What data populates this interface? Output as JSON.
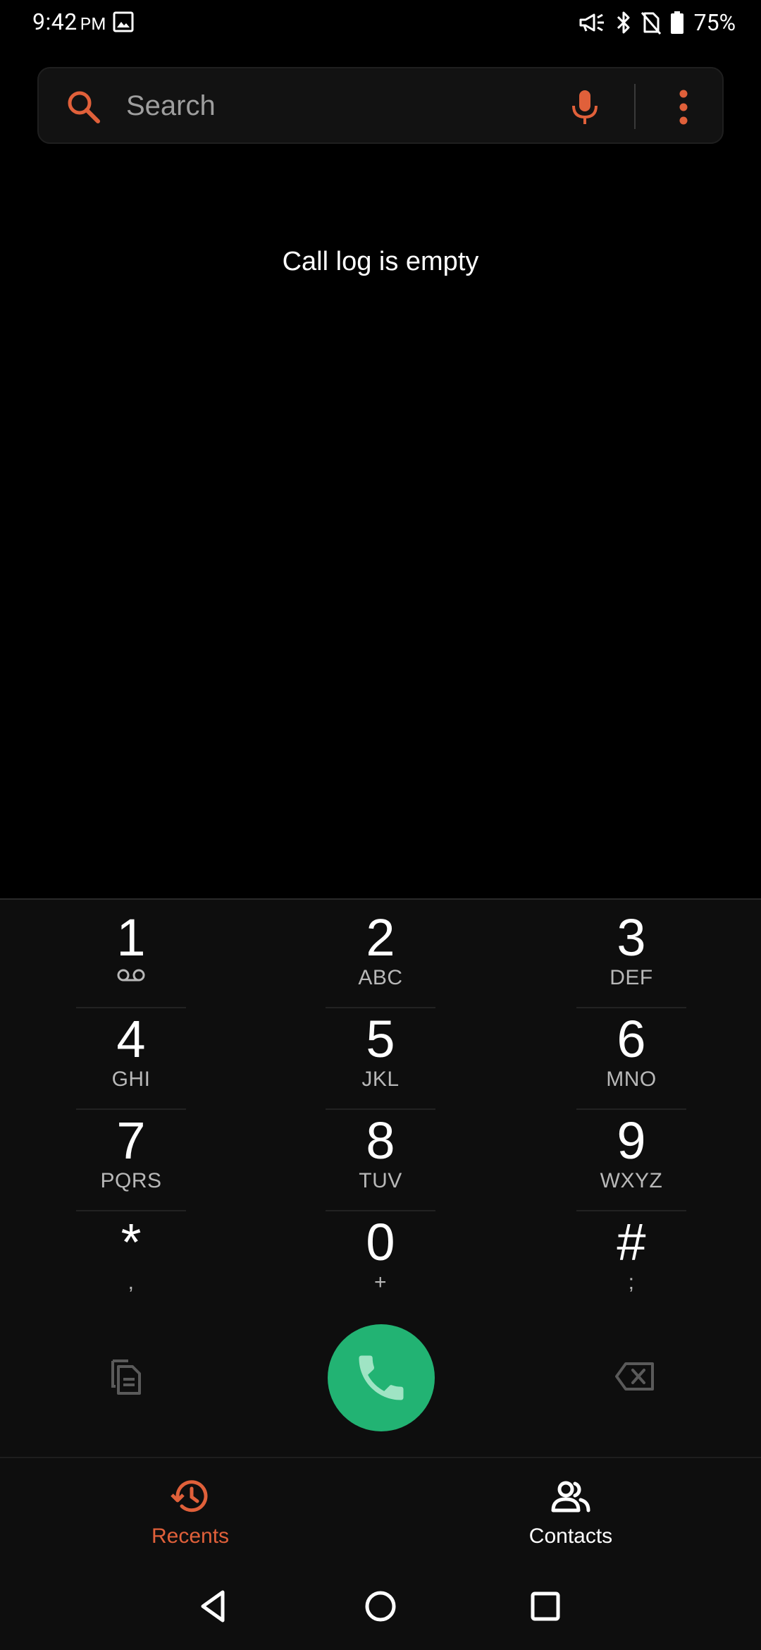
{
  "status_bar": {
    "time": "9:42",
    "ampm": "PM",
    "battery": "75%",
    "icons": [
      "gallery-icon",
      "megaphone-icon",
      "bluetooth-icon",
      "no-sim-icon",
      "battery-icon"
    ]
  },
  "search": {
    "placeholder": "Search"
  },
  "call_log": {
    "empty_message": "Call log is empty"
  },
  "dialpad": {
    "keys": [
      {
        "digit": "1",
        "letters": ""
      },
      {
        "digit": "2",
        "letters": "ABC"
      },
      {
        "digit": "3",
        "letters": "DEF"
      },
      {
        "digit": "4",
        "letters": "GHI"
      },
      {
        "digit": "5",
        "letters": "JKL"
      },
      {
        "digit": "6",
        "letters": "MNO"
      },
      {
        "digit": "7",
        "letters": "PQRS"
      },
      {
        "digit": "8",
        "letters": "TUV"
      },
      {
        "digit": "9",
        "letters": "WXYZ"
      },
      {
        "digit": "*",
        "letters": ","
      },
      {
        "digit": "0",
        "letters": "+"
      },
      {
        "digit": "#",
        "letters": ";"
      }
    ]
  },
  "tabs": [
    {
      "label": "Recents",
      "active": true
    },
    {
      "label": "Contacts",
      "active": false
    }
  ],
  "colors": {
    "accent": "#e0603a",
    "call_green": "#22b373",
    "background": "#000000",
    "panel": "#0e0e0e"
  }
}
